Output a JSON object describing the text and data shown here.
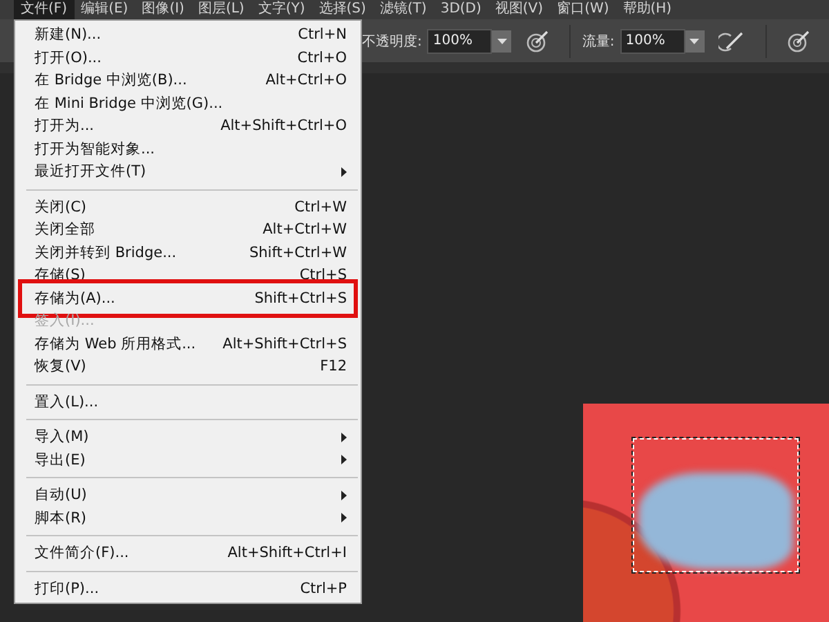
{
  "menu_bar": [
    {
      "label": "文件(F)",
      "selected": true
    },
    {
      "label": "编辑(E)",
      "selected": false
    },
    {
      "label": "图像(I)",
      "selected": false
    },
    {
      "label": "图层(L)",
      "selected": false
    },
    {
      "label": "文字(Y)",
      "selected": false
    },
    {
      "label": "选择(S)",
      "selected": false
    },
    {
      "label": "滤镜(T)",
      "selected": false
    },
    {
      "label": "3D(D)",
      "selected": false
    },
    {
      "label": "视图(V)",
      "selected": false
    },
    {
      "label": "窗口(W)",
      "selected": false
    },
    {
      "label": "帮助(H)",
      "selected": false
    }
  ],
  "options_bar": {
    "opacity_label": "不透明度:",
    "opacity_value": "100%",
    "flow_label": "流量:",
    "flow_value": "100%"
  },
  "file_menu": [
    {
      "kind": "item",
      "label": "新建(N)...",
      "shortcut": "Ctrl+N",
      "submenu": false,
      "disabled": false,
      "highlighted": false
    },
    {
      "kind": "item",
      "label": "打开(O)...",
      "shortcut": "Ctrl+O",
      "submenu": false,
      "disabled": false,
      "highlighted": false
    },
    {
      "kind": "item",
      "label": "在 Bridge 中浏览(B)...",
      "shortcut": "Alt+Ctrl+O",
      "submenu": false,
      "disabled": false,
      "highlighted": false
    },
    {
      "kind": "item",
      "label": "在 Mini Bridge 中浏览(G)...",
      "submenu": false,
      "disabled": false,
      "highlighted": false
    },
    {
      "kind": "item",
      "label": "打开为...",
      "shortcut": "Alt+Shift+Ctrl+O",
      "submenu": false,
      "disabled": false,
      "highlighted": false
    },
    {
      "kind": "item",
      "label": "打开为智能对象...",
      "submenu": false,
      "disabled": false,
      "highlighted": false
    },
    {
      "kind": "item",
      "label": "最近打开文件(T)",
      "submenu": true,
      "disabled": false,
      "highlighted": false
    },
    {
      "kind": "separator"
    },
    {
      "kind": "item",
      "label": "关闭(C)",
      "shortcut": "Ctrl+W",
      "submenu": false,
      "disabled": false,
      "highlighted": false
    },
    {
      "kind": "item",
      "label": "关闭全部",
      "shortcut": "Alt+Ctrl+W",
      "submenu": false,
      "disabled": false,
      "highlighted": false
    },
    {
      "kind": "item",
      "label": "关闭并转到 Bridge...",
      "shortcut": "Shift+Ctrl+W",
      "submenu": false,
      "disabled": false,
      "highlighted": false
    },
    {
      "kind": "item",
      "label": "存储(S)",
      "shortcut": "Ctrl+S",
      "submenu": false,
      "disabled": false,
      "highlighted": false
    },
    {
      "kind": "item",
      "label": "存储为(A)...",
      "shortcut": "Shift+Ctrl+S",
      "submenu": false,
      "disabled": false,
      "highlighted": true
    },
    {
      "kind": "item",
      "label": "签入(I)...",
      "submenu": false,
      "disabled": true,
      "highlighted": false
    },
    {
      "kind": "item",
      "label": "存储为 Web 所用格式...",
      "shortcut": "Alt+Shift+Ctrl+S",
      "submenu": false,
      "disabled": false,
      "highlighted": false
    },
    {
      "kind": "item",
      "label": "恢复(V)",
      "shortcut": "F12",
      "submenu": false,
      "disabled": false,
      "highlighted": false
    },
    {
      "kind": "separator"
    },
    {
      "kind": "item",
      "label": "置入(L)...",
      "submenu": false,
      "disabled": false,
      "highlighted": false
    },
    {
      "kind": "separator"
    },
    {
      "kind": "item",
      "label": "导入(M)",
      "submenu": true,
      "disabled": false,
      "highlighted": false
    },
    {
      "kind": "item",
      "label": "导出(E)",
      "submenu": true,
      "disabled": false,
      "highlighted": false
    },
    {
      "kind": "separator"
    },
    {
      "kind": "item",
      "label": "自动(U)",
      "submenu": true,
      "disabled": false,
      "highlighted": false
    },
    {
      "kind": "item",
      "label": "脚本(R)",
      "submenu": true,
      "disabled": false,
      "highlighted": false
    },
    {
      "kind": "separator"
    },
    {
      "kind": "item",
      "label": "文件简介(F)...",
      "shortcut": "Alt+Shift+Ctrl+I",
      "submenu": false,
      "disabled": false,
      "highlighted": false
    },
    {
      "kind": "separator"
    },
    {
      "kind": "item",
      "label": "打印(P)...",
      "shortcut": "Ctrl+P",
      "submenu": false,
      "disabled": false,
      "highlighted": false
    }
  ]
}
